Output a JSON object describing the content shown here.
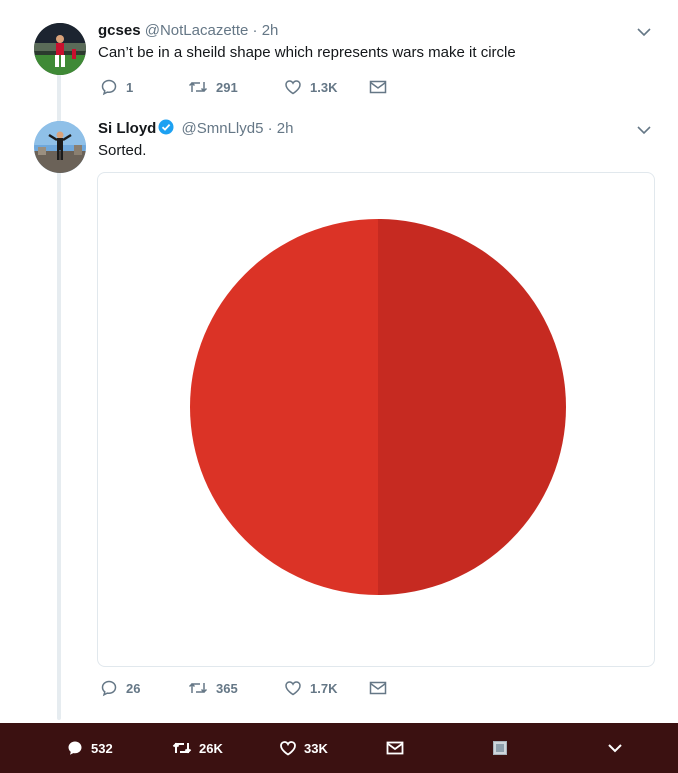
{
  "tweets": [
    {
      "display_name": "gcses",
      "username": "@NotLacazette",
      "separator": "·",
      "timestamp": "2h",
      "text": "Can’t be in a sheild shape which represents wars make it circle",
      "actions": {
        "replies": "1",
        "retweets": "291",
        "likes": "1.3K"
      }
    },
    {
      "display_name": "Si Lloyd",
      "username": "@SmnLlyd5",
      "separator": "·",
      "timestamp": "2h",
      "verified": true,
      "text": "Sorted.",
      "media": {
        "type": "image",
        "left_half_color": "#db3326",
        "right_half_color": "#c62a21"
      },
      "actions": {
        "replies": "26",
        "retweets": "365",
        "likes": "1.7K"
      }
    }
  ],
  "bottom_bar": {
    "replies": "532",
    "retweets": "26K",
    "likes": "33K"
  },
  "colors": {
    "muted": "#657786",
    "thread_line": "#e6ecf0",
    "verified": "#1da1f2",
    "bottom_bar": "#3b1111"
  }
}
